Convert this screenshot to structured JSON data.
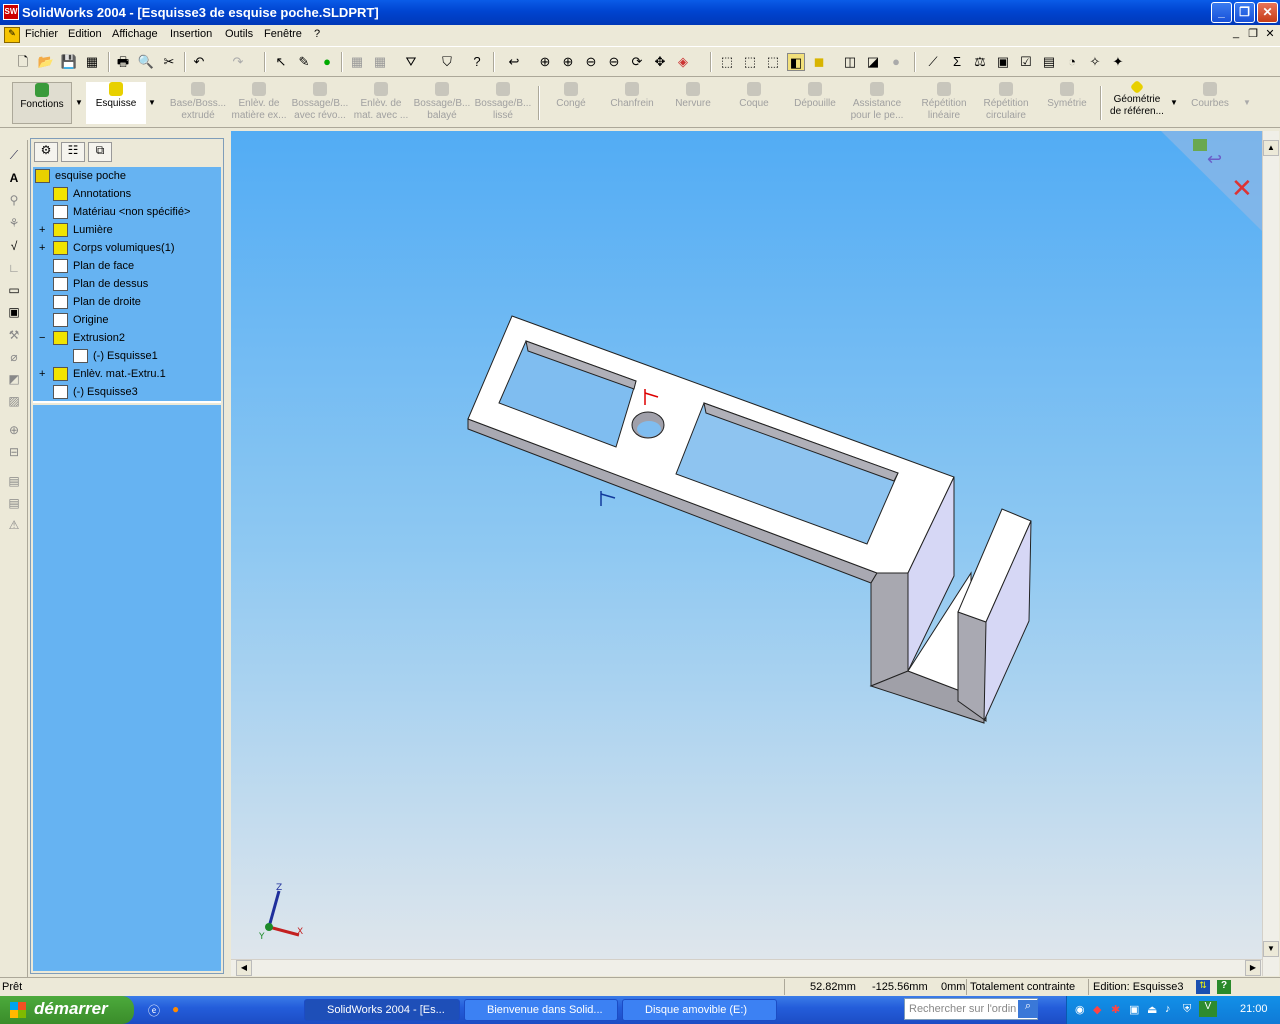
{
  "titlebar": {
    "title": "SolidWorks 2004 - [Esquisse3 de esquise poche.SLDPRT]",
    "app_icon": "SW"
  },
  "menu": [
    "Fichier",
    "Edition",
    "Affichage",
    "Insertion",
    "Outils",
    "Fenêtre",
    "?"
  ],
  "cmd": {
    "fonctions": "Fonctions",
    "esquisse": "Esquisse",
    "items": [
      {
        "l1": "Base/Boss...",
        "l2": "extrudé"
      },
      {
        "l1": "Enlèv. de",
        "l2": "matière ex..."
      },
      {
        "l1": "Bossage/B...",
        "l2": "avec révo..."
      },
      {
        "l1": "Enlèv. de",
        "l2": "mat. avec ..."
      },
      {
        "l1": "Bossage/B...",
        "l2": "balayé"
      },
      {
        "l1": "Bossage/B...",
        "l2": "lissé"
      },
      {
        "l1": "Congé",
        "l2": ""
      },
      {
        "l1": "Chanfrein",
        "l2": ""
      },
      {
        "l1": "Nervure",
        "l2": ""
      },
      {
        "l1": "Coque",
        "l2": ""
      },
      {
        "l1": "Dépouille",
        "l2": ""
      },
      {
        "l1": "Assistance",
        "l2": "pour le pe..."
      },
      {
        "l1": "Répétition",
        "l2": "linéaire"
      },
      {
        "l1": "Répétition",
        "l2": "circulaire"
      },
      {
        "l1": "Symétrie",
        "l2": ""
      }
    ],
    "geometrie_l1": "Géométrie",
    "geometrie_l2": "de référen...",
    "courbes": "Courbes"
  },
  "tree": [
    {
      "label": "esquise poche",
      "icon": "part-icon",
      "level": 0,
      "exp": ""
    },
    {
      "label": "Annotations",
      "icon": "annotations-icon",
      "level": 1,
      "exp": ""
    },
    {
      "label": "Matériau <non spécifié>",
      "icon": "material-icon",
      "level": 1,
      "exp": ""
    },
    {
      "label": "Lumière",
      "icon": "light-icon",
      "level": 1,
      "exp": "+"
    },
    {
      "label": "Corps volumiques(1)",
      "icon": "solid-bodies-icon",
      "level": 1,
      "exp": "+"
    },
    {
      "label": "Plan de face",
      "icon": "plane-icon",
      "level": 1,
      "exp": ""
    },
    {
      "label": "Plan de dessus",
      "icon": "plane-icon",
      "level": 1,
      "exp": ""
    },
    {
      "label": "Plan de droite",
      "icon": "plane-icon",
      "level": 1,
      "exp": ""
    },
    {
      "label": "Origine",
      "icon": "origin-icon",
      "level": 1,
      "exp": ""
    },
    {
      "label": "Extrusion2",
      "icon": "extrude-icon",
      "level": 1,
      "exp": "−"
    },
    {
      "label": "(-) Esquisse1",
      "icon": "sketch-icon",
      "level": 2,
      "exp": ""
    },
    {
      "label": "Enlèv. mat.-Extru.1",
      "icon": "cut-extrude-icon",
      "level": 1,
      "exp": "+"
    },
    {
      "label": "(-) Esquisse3",
      "icon": "sketch-icon",
      "level": 1,
      "exp": ""
    }
  ],
  "axes": {
    "x": "X",
    "y": "Y",
    "z": "Z"
  },
  "status": {
    "left": "Prêt",
    "x": "52.82mm",
    "y": "-125.56mm",
    "z": "0mm",
    "constraint": "Totalement contrainte",
    "edition": "Edition: Esquisse3",
    "help": "?"
  },
  "taskbar": {
    "start": "démarrer",
    "buttons": [
      "SolidWorks 2004 - [Es...",
      "Bienvenue dans Solid...",
      "Disque amovible (E:)"
    ],
    "search_placeholder": "Rechercher sur l'ordin",
    "clock": "21:00"
  },
  "colors": {
    "viewport_top": "#52acf4",
    "tree_bg": "#66b3f2",
    "part_face": "#ffffff",
    "part_side": "#a9a9b2",
    "part_end": "#d6d7f5"
  }
}
